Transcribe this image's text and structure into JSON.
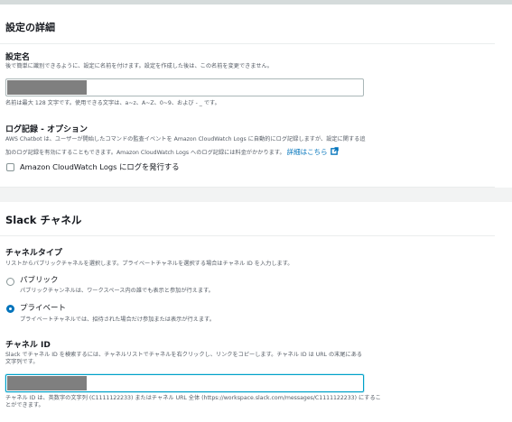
{
  "details": {
    "header": "設定の詳細",
    "config_name": {
      "label": "設定名",
      "description": "後で簡単に識別できるように、設定に名前を付けます。設定を作成した後は、この名前を変更できません。",
      "value": "",
      "constraint": "名前は最大 128 文字です。使用できる文字は、a~z、A~Z、0~9、および - _ です。"
    },
    "logging": {
      "label": "ログ記録 - オプション",
      "description_line1": "AWS Chatbot は、ユーザーが開始したコマンドの監査イベントを Amazon CloudWatch Logs に自動的にログ記録しますが、設定に関する追",
      "description_line2": "加のログ記録を有効にすることもできます。Amazon CloudWatch Logs へのログ記録には料金がかかります。",
      "link_text": "詳細はこちら",
      "checkbox_label": "Amazon CloudWatch Logs にログを発行する",
      "checked": false
    }
  },
  "slack": {
    "header": "Slack チャネル",
    "channel_type": {
      "label": "チャネルタイプ",
      "description": "リストからパブリックチャネルを選択します。プライベートチャネルを選択する場合はチャネル ID を入力します。",
      "options": [
        {
          "label": "パブリック",
          "description": "パブリックチャンネルは、ワークスペース内の誰でも表示と参加が行えます。",
          "checked": false
        },
        {
          "label": "プライベート",
          "description": "プライベートチャネルでは、招待された場合だけ参加または表示が行えます。",
          "checked": true
        }
      ]
    },
    "channel_id": {
      "label": "チャネル ID",
      "description_line1": "Slack でチャネル ID を検索するには、チャネルリストでチャネルを右クリックし、リンクをコピーします。チャネル ID は URL の末尾にある",
      "description_line2": "文字列です。",
      "value": "",
      "hint_line1": "チャネル ID は、英数字の文字列 (C1111122233) またはチャネル URL 全体 (https://workspace.slack.com/messages/C1111122233) にするこ",
      "hint_line2": "とができます。"
    }
  },
  "colors": {
    "link": "#0073bb",
    "radio_selected": "#0073bb",
    "input_focus": "#00a1c9",
    "header_divider": "#eaeded",
    "gap_band": "#f2f3f3"
  }
}
